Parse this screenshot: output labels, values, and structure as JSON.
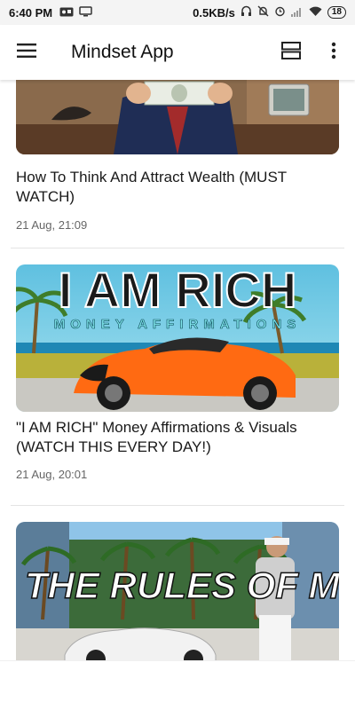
{
  "status_bar": {
    "time": "6:40 PM",
    "network_speed": "0.5KB/s",
    "battery": "18"
  },
  "app_bar": {
    "title": "Mindset App",
    "icons": [
      "hamburger-menu-icon",
      "view-layout-icon",
      "more-vert-icon"
    ]
  },
  "feed": {
    "items": [
      {
        "title": "How To Think And Attract Wealth (MUST WATCH)",
        "date": "21 Aug, 21:09"
      },
      {
        "title": "\"I AM RICH\" Money Affirmations & Visuals (WATCH THIS EVERY DAY!)",
        "date": "21 Aug, 20:01",
        "thumb_text_1": "I AM RICH",
        "thumb_text_2": "MONEY AFFIRMATIONS"
      },
      {
        "title": "",
        "thumb_text_1": "THE RULES OF MONEY"
      }
    ]
  }
}
